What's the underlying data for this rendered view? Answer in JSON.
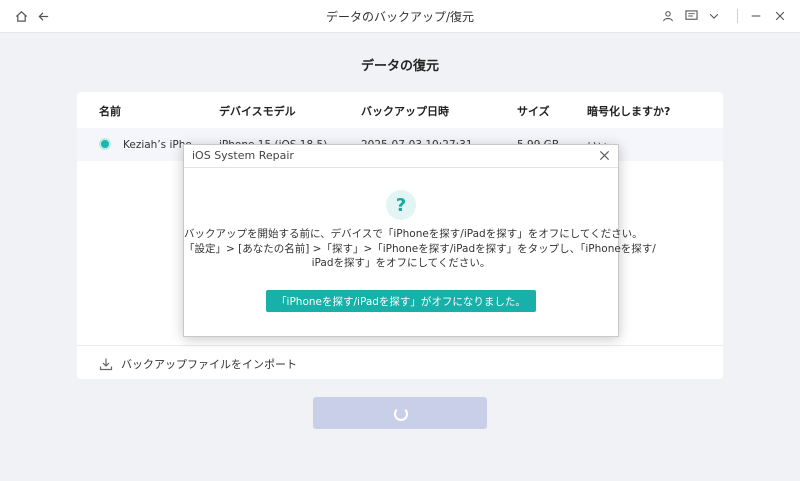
{
  "titlebar": {
    "title": "データのバックアップ/復元",
    "icons": [
      "home-icon",
      "back-arrow-icon",
      "user-icon",
      "feedback-icon",
      "chevron-down-icon",
      "minimize-icon",
      "close-icon"
    ]
  },
  "page": {
    "title": "データの復元"
  },
  "table": {
    "headers": [
      "名前",
      "デバイスモデル",
      "バックアップ日時",
      "サイズ",
      "暗号化しますか?"
    ],
    "rows": [
      {
        "name": "Keziah’s iPho",
        "model": "iPhone 15 (iOS 18.5)",
        "date": "2025-07-03 10:27:31",
        "size": "5.99 GB",
        "encrypted": "はい"
      }
    ]
  },
  "import": {
    "label": "バックアップファイルをインポート"
  },
  "dialog": {
    "title": "iOS System Repair",
    "lines": [
      "バックアップを開始する前に、デバイスで「iPhoneを探す/iPadを探す」をオフにしてください。",
      "「設定」> [あなたの名前] >「探す」>「iPhoneを探す/iPadを探す」をタップし、「iPhoneを探す/",
      "iPadを探す」をオフにしてください。"
    ],
    "confirm_label": "「iPhoneを探す/iPadを探す」がオフになりました。",
    "icon_glyph": "?"
  },
  "colors": {
    "accent": "#17b1a9",
    "disabled_button": "#c9cfe8",
    "background": "#f1f2f5"
  }
}
